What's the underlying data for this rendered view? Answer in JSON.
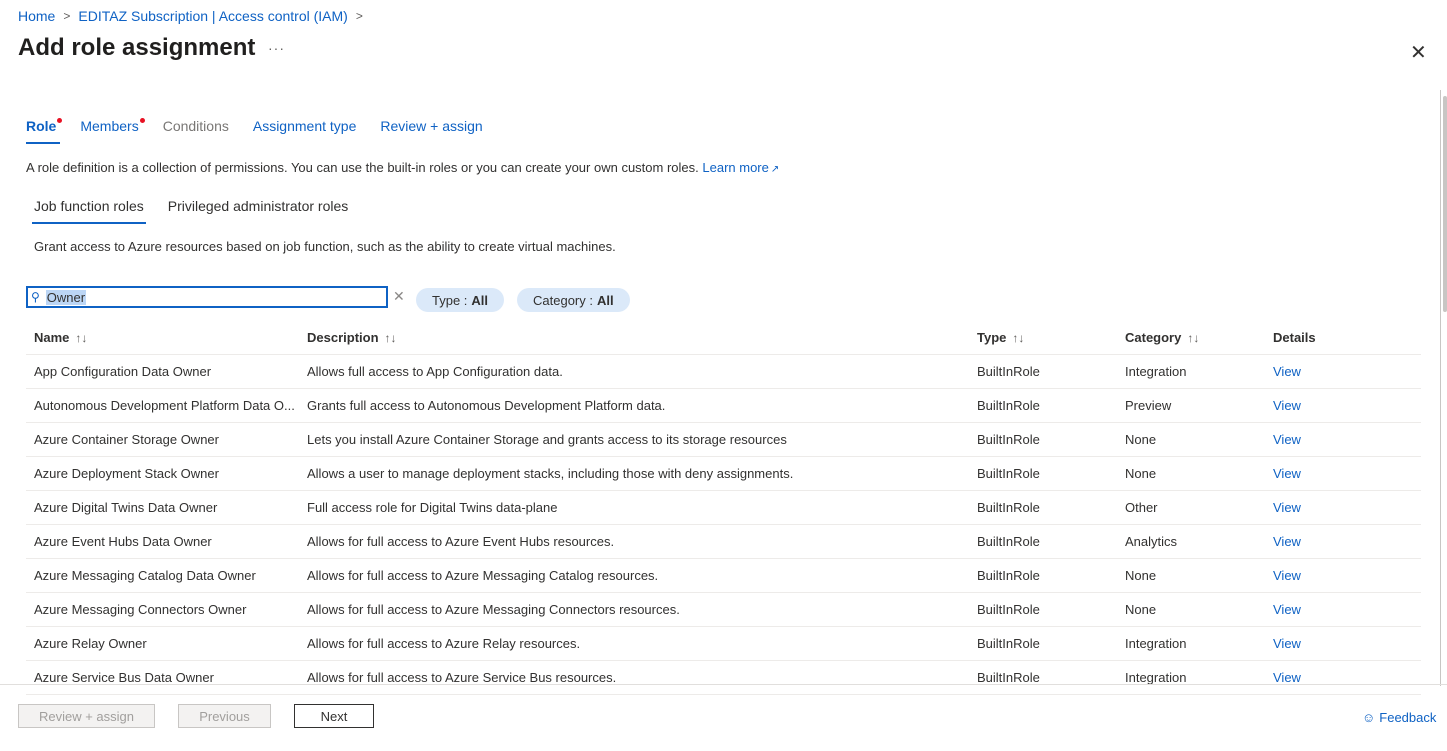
{
  "breadcrumb": {
    "home": "Home",
    "subscription": "EDITAZ Subscription | Access control (IAM)",
    "sep": ">"
  },
  "page": {
    "title": "Add role assignment",
    "more": "···",
    "close": "✕"
  },
  "tabs": [
    {
      "label": "Role"
    },
    {
      "label": "Members"
    },
    {
      "label": "Conditions"
    },
    {
      "label": "Assignment type"
    },
    {
      "label": "Review + assign"
    }
  ],
  "role_desc": {
    "text": "A role definition is a collection of permissions. You can use the built-in roles or you can create your own custom roles.",
    "learn_more": "Learn more"
  },
  "subtabs": [
    {
      "label": "Job function roles"
    },
    {
      "label": "Privileged administrator roles"
    }
  ],
  "subtab_desc": "Grant access to Azure resources based on job function, such as the ability to create virtual machines.",
  "search": {
    "value": "Owner"
  },
  "filters": {
    "type": {
      "label": "Type :",
      "value": "All"
    },
    "category": {
      "label": "Category :",
      "value": "All"
    }
  },
  "table": {
    "headers": {
      "name": "Name",
      "description": "Description",
      "type": "Type",
      "category": "Category",
      "details": "Details"
    },
    "rows": [
      {
        "name": "App Configuration Data Owner",
        "description": "Allows full access to App Configuration data.",
        "type": "BuiltInRole",
        "category": "Integration",
        "details": "View"
      },
      {
        "name": "Autonomous Development Platform Data O...",
        "description": "Grants full access to Autonomous Development Platform data.",
        "type": "BuiltInRole",
        "category": "Preview",
        "details": "View"
      },
      {
        "name": "Azure Container Storage Owner",
        "description": "Lets you install Azure Container Storage and grants access to its storage resources",
        "type": "BuiltInRole",
        "category": "None",
        "details": "View"
      },
      {
        "name": "Azure Deployment Stack Owner",
        "description": "Allows a user to manage deployment stacks, including those with deny assignments.",
        "type": "BuiltInRole",
        "category": "None",
        "details": "View"
      },
      {
        "name": "Azure Digital Twins Data Owner",
        "description": "Full access role for Digital Twins data-plane",
        "type": "BuiltInRole",
        "category": "Other",
        "details": "View"
      },
      {
        "name": "Azure Event Hubs Data Owner",
        "description": "Allows for full access to Azure Event Hubs resources.",
        "type": "BuiltInRole",
        "category": "Analytics",
        "details": "View"
      },
      {
        "name": "Azure Messaging Catalog Data Owner",
        "description": "Allows for full access to Azure Messaging Catalog resources.",
        "type": "BuiltInRole",
        "category": "None",
        "details": "View"
      },
      {
        "name": "Azure Messaging Connectors Owner",
        "description": "Allows for full access to Azure Messaging Connectors resources.",
        "type": "BuiltInRole",
        "category": "None",
        "details": "View"
      },
      {
        "name": "Azure Relay Owner",
        "description": "Allows for full access to Azure Relay resources.",
        "type": "BuiltInRole",
        "category": "Integration",
        "details": "View"
      },
      {
        "name": "Azure Service Bus Data Owner",
        "description": "Allows for full access to Azure Service Bus resources.",
        "type": "BuiltInRole",
        "category": "Integration",
        "details": "View"
      }
    ]
  },
  "footer": {
    "review_assign": "Review + assign",
    "previous": "Previous",
    "next": "Next",
    "feedback": "Feedback"
  },
  "colors": {
    "accent": "#0f62c4",
    "required_dot": "#e81123",
    "pill_bg": "#dbe9f9"
  }
}
